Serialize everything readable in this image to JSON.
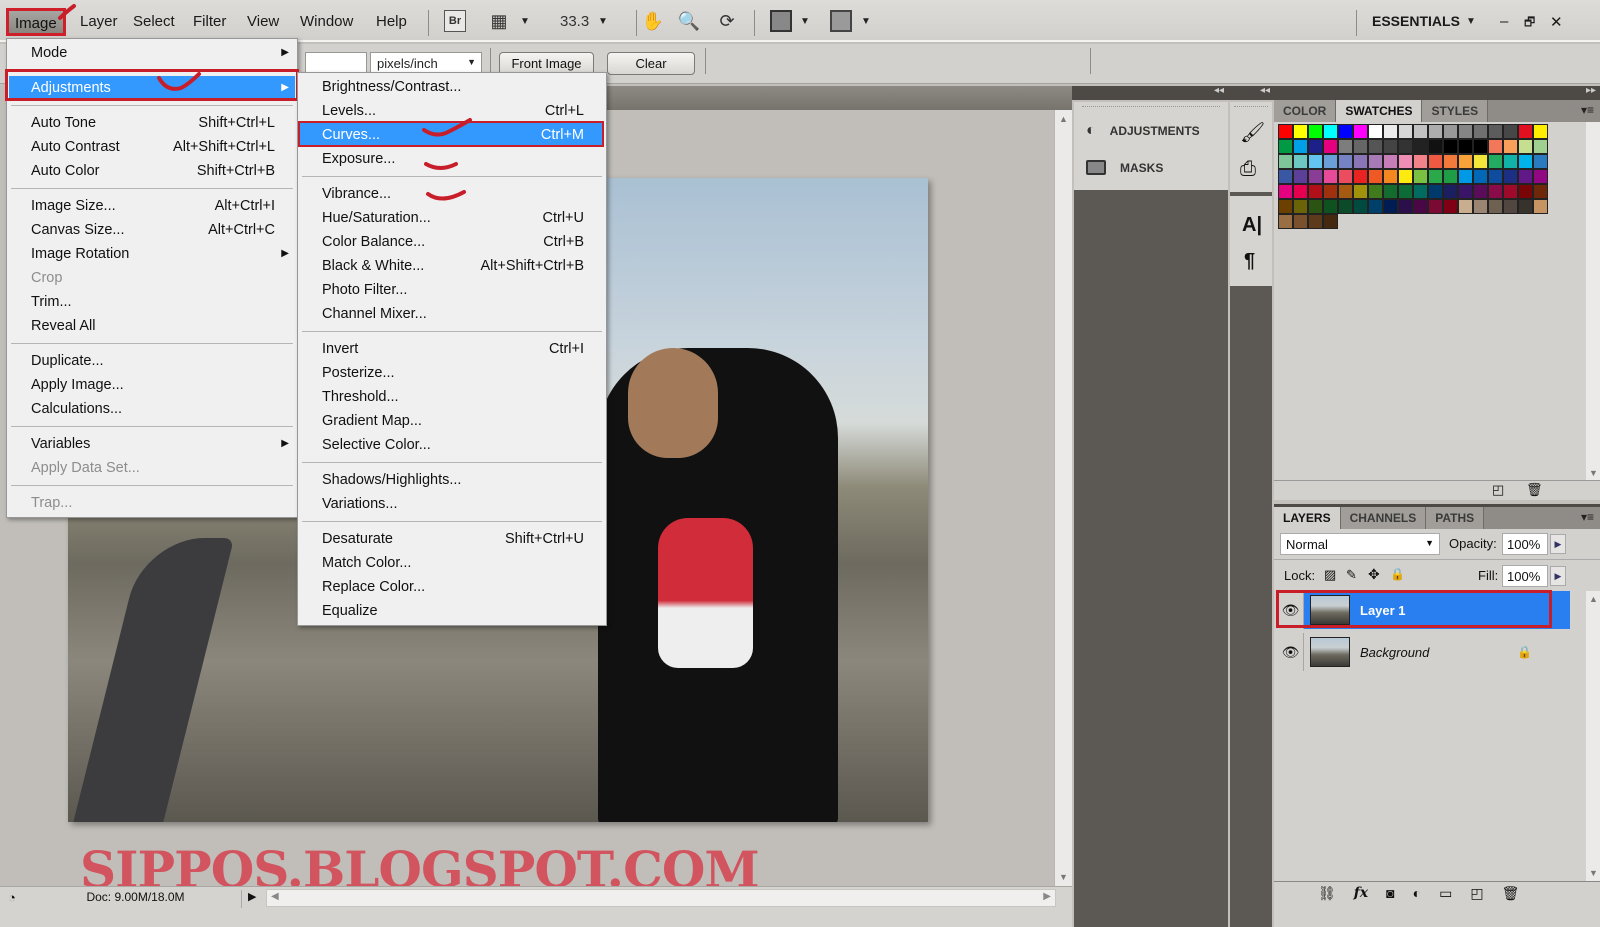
{
  "menubar": {
    "items": [
      "Image",
      "Layer",
      "Select",
      "Filter",
      "View",
      "Window",
      "Help"
    ],
    "zoom_value": "33.3",
    "workspace": "ESSENTIALS",
    "icons": [
      "bridge-icon",
      "minibridge-icon",
      "hand-icon",
      "zoom-icon",
      "rotate-view-icon",
      "arrange-documents-icon",
      "screen-mode-icon"
    ],
    "bridge_label": "Br"
  },
  "window_controls": {
    "minimize": "–",
    "restore": "🗗",
    "close": "✕"
  },
  "options_bar": {
    "resolution_unit": "pixels/inch",
    "front_image_label": "Front Image",
    "clear_label": "Clear"
  },
  "image_menu": {
    "items": [
      {
        "label": "Mode",
        "shortcut": "",
        "submenu": true,
        "disabled": false
      },
      {
        "sep": true
      },
      {
        "label": "Adjustments",
        "shortcut": "",
        "submenu": true,
        "highlighted": true
      },
      {
        "sep": true
      },
      {
        "label": "Auto Tone",
        "shortcut": "Shift+Ctrl+L"
      },
      {
        "label": "Auto Contrast",
        "shortcut": "Alt+Shift+Ctrl+L"
      },
      {
        "label": "Auto Color",
        "shortcut": "Shift+Ctrl+B"
      },
      {
        "sep": true
      },
      {
        "label": "Image Size...",
        "shortcut": "Alt+Ctrl+I"
      },
      {
        "label": "Canvas Size...",
        "shortcut": "Alt+Ctrl+C"
      },
      {
        "label": "Image Rotation",
        "shortcut": "",
        "submenu": true
      },
      {
        "label": "Crop",
        "shortcut": "",
        "disabled": true
      },
      {
        "label": "Trim...",
        "shortcut": ""
      },
      {
        "label": "Reveal All",
        "shortcut": ""
      },
      {
        "sep": true
      },
      {
        "label": "Duplicate...",
        "shortcut": ""
      },
      {
        "label": "Apply Image...",
        "shortcut": ""
      },
      {
        "label": "Calculations...",
        "shortcut": ""
      },
      {
        "sep": true
      },
      {
        "label": "Variables",
        "shortcut": "",
        "submenu": true
      },
      {
        "label": "Apply Data Set...",
        "shortcut": "",
        "disabled": true
      },
      {
        "sep": true
      },
      {
        "label": "Trap...",
        "shortcut": "",
        "disabled": true
      }
    ]
  },
  "adjustments_menu": {
    "items": [
      {
        "label": "Brightness/Contrast...",
        "shortcut": ""
      },
      {
        "label": "Levels...",
        "shortcut": "Ctrl+L"
      },
      {
        "label": "Curves...",
        "shortcut": "Ctrl+M",
        "highlighted": true
      },
      {
        "label": "Exposure...",
        "shortcut": ""
      },
      {
        "sep": true
      },
      {
        "label": "Vibrance...",
        "shortcut": ""
      },
      {
        "label": "Hue/Saturation...",
        "shortcut": "Ctrl+U"
      },
      {
        "label": "Color Balance...",
        "shortcut": "Ctrl+B"
      },
      {
        "label": "Black & White...",
        "shortcut": "Alt+Shift+Ctrl+B"
      },
      {
        "label": "Photo Filter...",
        "shortcut": ""
      },
      {
        "label": "Channel Mixer...",
        "shortcut": ""
      },
      {
        "sep": true
      },
      {
        "label": "Invert",
        "shortcut": "Ctrl+I"
      },
      {
        "label": "Posterize...",
        "shortcut": ""
      },
      {
        "label": "Threshold...",
        "shortcut": ""
      },
      {
        "label": "Gradient Map...",
        "shortcut": ""
      },
      {
        "label": "Selective Color...",
        "shortcut": ""
      },
      {
        "sep": true
      },
      {
        "label": "Shadows/Highlights...",
        "shortcut": ""
      },
      {
        "label": "Variations...",
        "shortcut": ""
      },
      {
        "sep": true
      },
      {
        "label": "Desaturate",
        "shortcut": "Shift+Ctrl+U"
      },
      {
        "label": "Match Color...",
        "shortcut": ""
      },
      {
        "label": "Replace Color...",
        "shortcut": ""
      },
      {
        "label": "Equalize",
        "shortcut": ""
      }
    ]
  },
  "dock": {
    "adjustments_label": "ADJUSTMENTS",
    "masks_label": "MASKS"
  },
  "swatches_panel": {
    "tabs": [
      "COLOR",
      "SWATCHES",
      "STYLES"
    ],
    "active_tab": "SWATCHES",
    "swatches": [
      "#ff0000",
      "#ffff00",
      "#00ff00",
      "#00ffff",
      "#0000ff",
      "#ff00ff",
      "#ffffff",
      "#ebebeb",
      "#d6d6d6",
      "#c2c2c2",
      "#adadad",
      "#999999",
      "#858585",
      "#707070",
      "#5c5c5c",
      "#474747",
      "#e01020",
      "#ffee00",
      "#009944",
      "#00a0e9",
      "#1d2088",
      "#e4007f",
      "#7d7d7d",
      "#666666",
      "#555555",
      "#444444",
      "#333333",
      "#222222",
      "#111111",
      "#000000",
      "#000000",
      "#000000",
      "#f3775a",
      "#f8a05a",
      "#c6de8f",
      "#9fd08f",
      "#7fc59a",
      "#6cc8c0",
      "#62c4ef",
      "#6a9fd8",
      "#7583c5",
      "#8a76b6",
      "#a77ab5",
      "#c67db8",
      "#f08db5",
      "#f4828a",
      "#f05a42",
      "#f47a3c",
      "#f8a23a",
      "#f2e63a",
      "#23ab61",
      "#11b2a8",
      "#00b3ea",
      "#2a7ac0",
      "#3a57a4",
      "#5b3f98",
      "#8a3d96",
      "#e84a9a",
      "#ec4c60",
      "#e92222",
      "#ef5a24",
      "#f48820",
      "#fcea10",
      "#7ac143",
      "#2aa84a",
      "#1e9c46",
      "#0099e5",
      "#0068b7",
      "#0f4c9e",
      "#1c2f83",
      "#601986",
      "#920783",
      "#e4007f",
      "#e5004f",
      "#b21018",
      "#a0310f",
      "#a45b11",
      "#a0920b",
      "#3f7a1c",
      "#146b2e",
      "#0c6b36",
      "#006b5e",
      "#00396b",
      "#1c1f5f",
      "#3a1466",
      "#5a0c5b",
      "#8a0b4a",
      "#a00a2a",
      "#7a0506",
      "#6c2808",
      "#6c4100",
      "#6b6307",
      "#2b5412",
      "#0e5220",
      "#0c4b2a",
      "#004a40",
      "#003f6a",
      "#001d53",
      "#2c0f4a",
      "#4a0745",
      "#7a0a33",
      "#7f0015",
      "#c8ae8f",
      "#9a8573",
      "#6f6152",
      "#514740",
      "#38322c",
      "#c69462",
      "#9a6e43",
      "#7b512d",
      "#5e3a1c",
      "#44280f"
    ]
  },
  "layers_panel": {
    "tabs": [
      "LAYERS",
      "CHANNELS",
      "PATHS"
    ],
    "active_tab": "LAYERS",
    "blend_mode": "Normal",
    "opacity_label": "Opacity:",
    "opacity": "100%",
    "lock_label": "Lock:",
    "fill_label": "Fill:",
    "fill": "100%",
    "layers": [
      {
        "name": "Layer 1",
        "visible": true,
        "selected": true,
        "locked": false
      },
      {
        "name": "Background",
        "visible": true,
        "selected": false,
        "locked": true
      }
    ],
    "footer_icons": [
      "link-layers-icon",
      "fx-icon",
      "add-mask-icon",
      "adjustment-layer-icon",
      "new-group-icon",
      "new-layer-icon",
      "delete-layer-icon"
    ]
  },
  "status_bar": {
    "doc_size": "Doc: 9.00M/18.0M"
  },
  "watermark": "SIPPOS.BLOGSPOT.COM",
  "annotation_color": "#c81e2a",
  "highlight_color": "#3399ff"
}
